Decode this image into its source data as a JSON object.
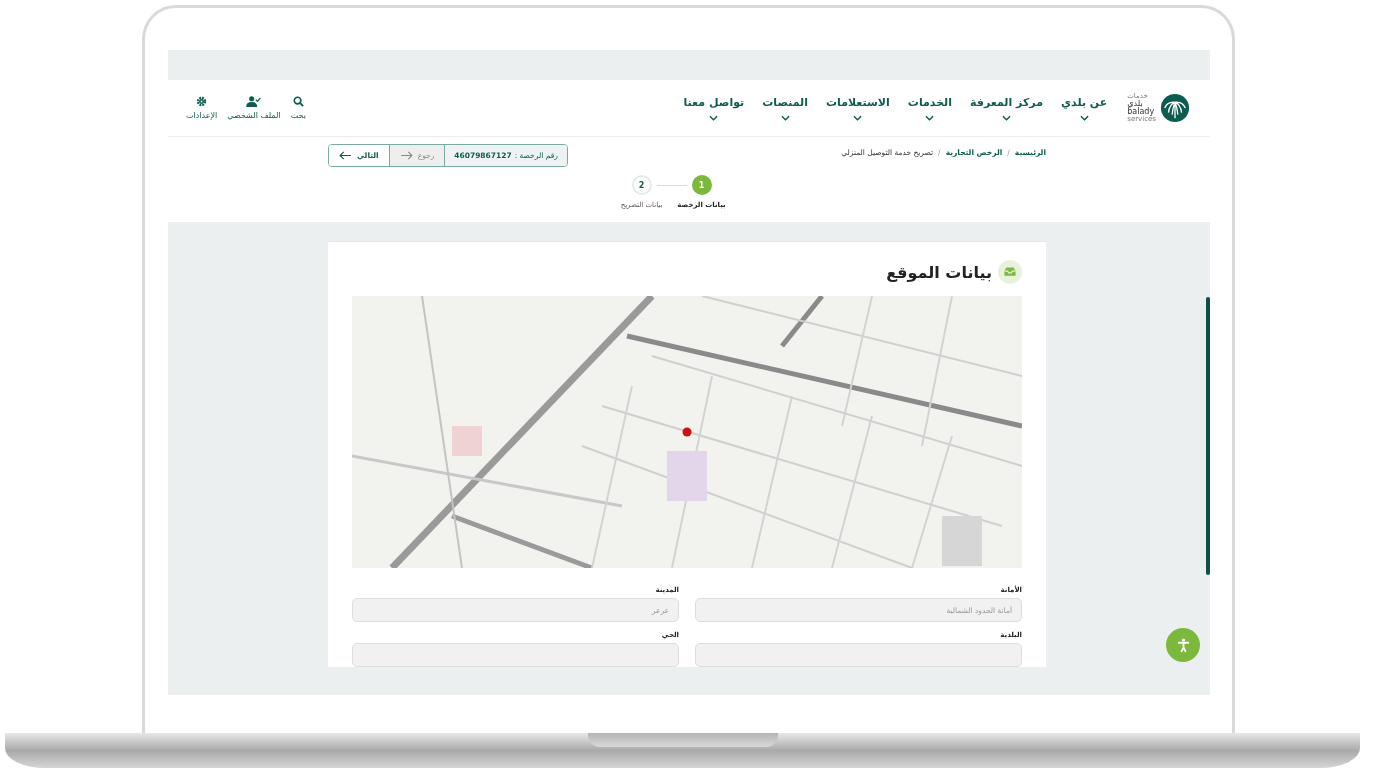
{
  "logo": {
    "arabic_top": "خدمات",
    "arabic_name": "بلدي",
    "latin_name": "balady",
    "latin_sub": "services"
  },
  "nav": [
    {
      "label": "عن بلدي"
    },
    {
      "label": "مركز المعرفة"
    },
    {
      "label": "الخدمات"
    },
    {
      "label": "الاستعلامات"
    },
    {
      "label": "المنصات"
    },
    {
      "label": "تواصل معنا"
    }
  ],
  "tools": [
    {
      "kind": "search",
      "label": "بحث"
    },
    {
      "kind": "profile",
      "label": "الملف الشخصي"
    },
    {
      "kind": "settings",
      "label": "الإعدادات"
    }
  ],
  "breadcrumb": [
    {
      "kind": "link",
      "text": "الرئيسية"
    },
    {
      "kind": "separator",
      "text": "/"
    },
    {
      "kind": "link",
      "text": "الرخص التجارية"
    },
    {
      "kind": "separator",
      "text": "/"
    },
    {
      "kind": "current",
      "text": "تصريح خدمة التوصيل المنزلي"
    }
  ],
  "license": {
    "label": "رقم الرخصة :",
    "number": "46079867127"
  },
  "actions": [
    {
      "kind": "back",
      "label": "رجوع",
      "disabled": true
    },
    {
      "kind": "next",
      "label": "التالي",
      "disabled": false
    }
  ],
  "steps": [
    {
      "number": "1",
      "label": "بيانات الرخصة",
      "selected": true
    },
    {
      "number": "2",
      "label": "بيانات التصريح",
      "selected": false
    }
  ],
  "section": {
    "title": "بيانات الموقع"
  },
  "fields": [
    {
      "label": "الأمانة",
      "value": "أمانة الحدود الشمالية",
      "disabled": true
    },
    {
      "label": "المدينة",
      "value": "عرعر",
      "disabled": true
    },
    {
      "label": "البلدية",
      "disabled": true
    },
    {
      "label": "الحي",
      "disabled": true
    }
  ]
}
